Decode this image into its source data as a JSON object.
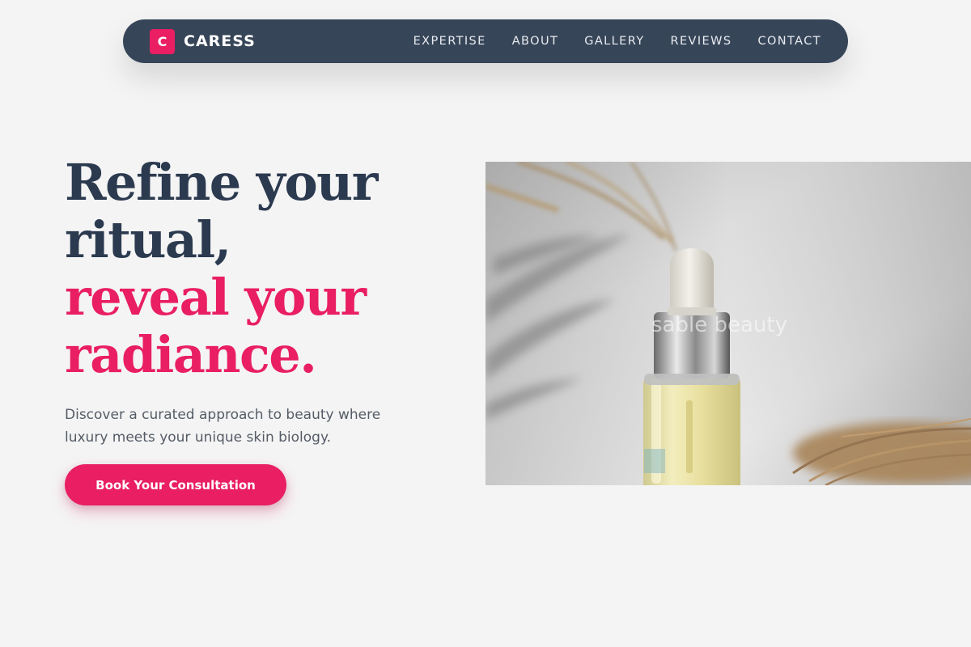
{
  "brand": {
    "mark": "C",
    "name": "CARESS"
  },
  "nav": {
    "items": [
      {
        "label": "EXPERTISE"
      },
      {
        "label": "ABOUT"
      },
      {
        "label": "GALLERY"
      },
      {
        "label": "REVIEWS"
      },
      {
        "label": "CONTACT"
      }
    ]
  },
  "hero": {
    "title_line1": "Refine your",
    "title_line2": "ritual,",
    "title_line3": "reveal your",
    "title_line4": "radiance.",
    "subtitle": "Discover a curated approach to beauty where luxury meets your unique skin biology.",
    "cta_label": "Book Your Consultation"
  },
  "image": {
    "watermark": "sable beauty"
  },
  "colors": {
    "nav_bg": "#374558",
    "accent": "#e91e63",
    "heading_dark": "#2b3a4f",
    "page_bg": "#f4f4f4"
  }
}
